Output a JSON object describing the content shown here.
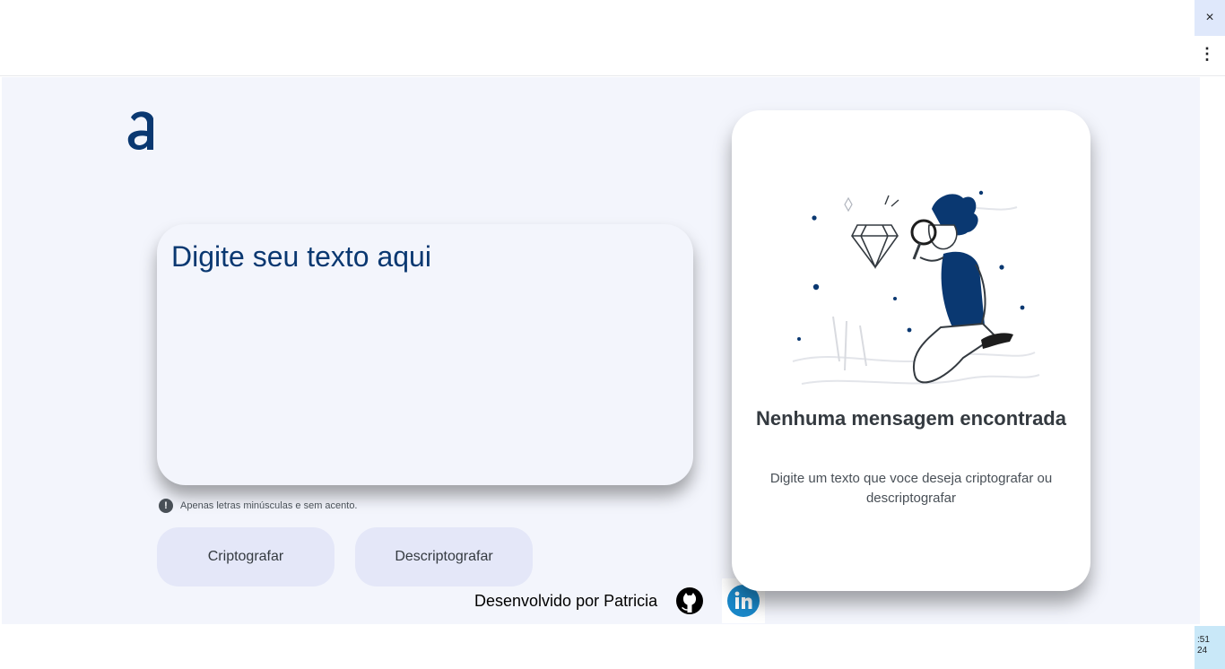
{
  "browser": {
    "close_glyph": "×",
    "menu_glyph": "⋮",
    "clock_line1": ":51",
    "clock_line2": "24"
  },
  "input": {
    "placeholder": "Digite seu texto aqui"
  },
  "hint": {
    "icon": "!",
    "text": "Apenas letras minúsculas e sem acento."
  },
  "buttons": {
    "encrypt": "Criptografar",
    "decrypt": "Descriptografar"
  },
  "footer": {
    "text": "Desenvolvido por Patricia"
  },
  "output": {
    "title": "Nenhuma mensagem encontrada",
    "message": "Digite um texto que voce deseja criptografar ou descriptografar"
  },
  "colors": {
    "brand": "#0a3871",
    "background": "#f3f5fc",
    "button": "#e4e7f8",
    "linkedin": "#1a88c9"
  },
  "icons": [
    "alura-logo-icon",
    "info-icon",
    "github-icon",
    "linkedin-icon",
    "detective-illustration"
  ]
}
